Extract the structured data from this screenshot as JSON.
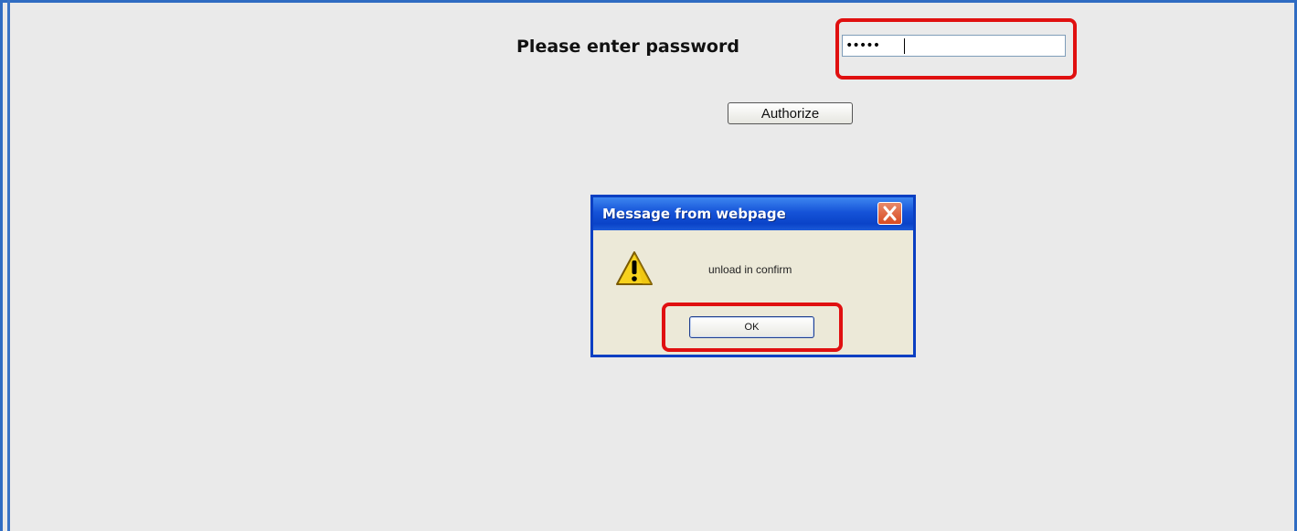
{
  "auth_form": {
    "password_label": "Please enter password",
    "password_value": "•••••",
    "authorize_label": "Authorize"
  },
  "dialog": {
    "title": "Message from webpage",
    "message": "unload in confirm",
    "ok_label": "OK",
    "icon": "warning-icon",
    "close_icon": "close-icon"
  },
  "colors": {
    "page_background": "#eaeaea",
    "frame_border": "#2f6cc2",
    "highlight": "#e01010",
    "dialog_title_bar": "#1553d8",
    "dialog_body": "#ece9d8"
  }
}
